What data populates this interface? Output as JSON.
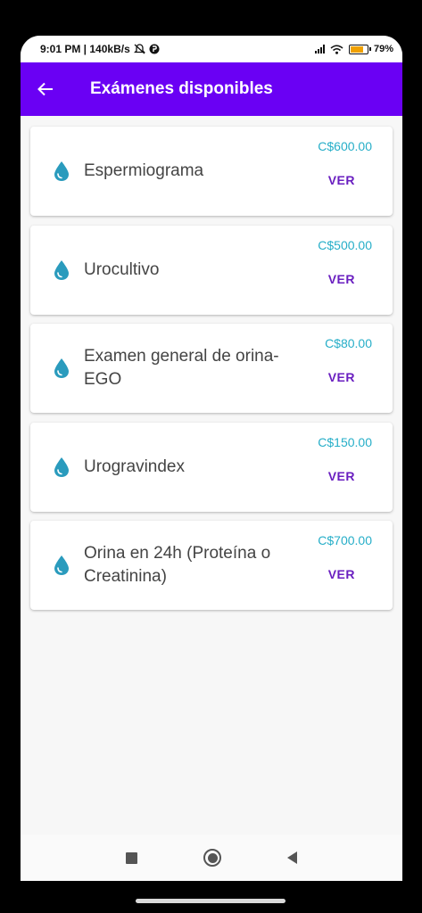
{
  "status_bar": {
    "time_speed": "9:01 PM | 140kB/s",
    "battery": "79%",
    "battery_level": 0.79
  },
  "appbar": {
    "title": "Exámenes disponibles",
    "back_icon": "arrow-back-icon"
  },
  "exams": [
    {
      "name": "Espermiograma",
      "price": "C$600.00",
      "action": "VER"
    },
    {
      "name": "Urocultivo",
      "price": "C$500.00",
      "action": "VER"
    },
    {
      "name": "Examen general de orina-EGO",
      "price": "C$80.00",
      "action": "VER"
    },
    {
      "name": "Urogravindex",
      "price": "C$150.00",
      "action": "VER"
    },
    {
      "name": "Orina en 24h (Proteína o Creatinina)",
      "price": "C$700.00",
      "action": "VER"
    }
  ],
  "colors": {
    "appbar": "#6a00f4",
    "price": "#26aec8",
    "action": "#6a1fc0",
    "drop_icon": "#2a9bbd"
  },
  "navbar": {
    "icons": [
      "recents-square-icon",
      "home-circle-icon",
      "back-triangle-icon"
    ]
  }
}
